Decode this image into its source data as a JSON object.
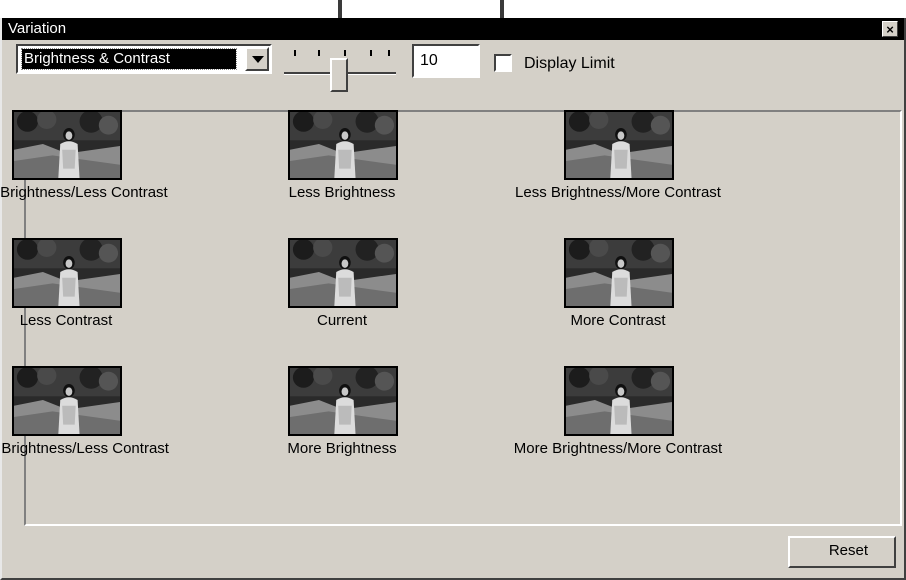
{
  "window": {
    "title": "Variation",
    "close_glyph": "×",
    "accent": "#000000",
    "face": "#d4d0c8"
  },
  "toolbar": {
    "mode_selected": "Brightness & Contrast",
    "slider_value": "10",
    "slider_level": 0.5,
    "display_limit_label": "Display Limit",
    "display_limit_checked": false
  },
  "variations": [
    {
      "label": "Less Brightness/Less Contrast"
    },
    {
      "label": "Less Brightness"
    },
    {
      "label": "Less Brightness/More Contrast"
    },
    {
      "label": "Less Contrast"
    },
    {
      "label": "Current"
    },
    {
      "label": "More Contrast"
    },
    {
      "label": "More Brightness/Less Contrast"
    },
    {
      "label": "More Brightness"
    },
    {
      "label": "More Brightness/More Contrast"
    }
  ],
  "footer": {
    "reset_label": "Reset"
  }
}
